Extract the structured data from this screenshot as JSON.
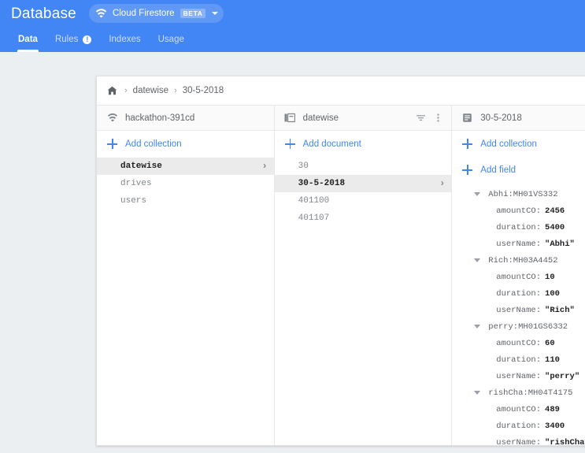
{
  "header": {
    "title": "Database",
    "product_chip": {
      "icon": "firestore-icon",
      "label": "Cloud Firestore",
      "badge": "BETA",
      "caret": "chevron-down-icon"
    },
    "accent_color": "#4285f4",
    "tabs": [
      {
        "label": "Data",
        "active": true,
        "badge": null
      },
      {
        "label": "Rules",
        "active": false,
        "badge": "!"
      },
      {
        "label": "Indexes",
        "active": false,
        "badge": null
      },
      {
        "label": "Usage",
        "active": false,
        "badge": null
      }
    ]
  },
  "breadcrumb": {
    "home_icon": "home-icon",
    "separator": "›",
    "items": [
      "datewise",
      "30-5-2018"
    ]
  },
  "panes": {
    "root": {
      "icon": "firestore-icon",
      "title": "hackathon-391cd",
      "add_label": "Add collection",
      "items": [
        {
          "name": "datewise",
          "selected": true
        },
        {
          "name": "drives",
          "selected": false
        },
        {
          "name": "users",
          "selected": false
        }
      ]
    },
    "collection": {
      "icon": "collection-icon",
      "title": "datewise",
      "filter_icon": "filter-icon",
      "menu_icon": "more-vert-icon",
      "add_label": "Add document",
      "items": [
        {
          "name": "30",
          "selected": false
        },
        {
          "name": "30-5-2018",
          "selected": true
        },
        {
          "name": "401100",
          "selected": false
        },
        {
          "name": "401107",
          "selected": false
        }
      ]
    },
    "document": {
      "icon": "document-icon",
      "title": "30-5-2018",
      "add_collection_label": "Add collection",
      "add_field_label": "Add field",
      "groups": [
        {
          "key": "Abhi:MH01VS332",
          "fields": [
            {
              "name": "amountCO",
              "value": "2456"
            },
            {
              "name": "duration",
              "value": "5400"
            },
            {
              "name": "userName",
              "value": "\"Abhi\""
            }
          ]
        },
        {
          "key": "Rich:MH03A4452",
          "fields": [
            {
              "name": "amountCO",
              "value": "10"
            },
            {
              "name": "duration",
              "value": "100"
            },
            {
              "name": "userName",
              "value": "\"Rich\""
            }
          ]
        },
        {
          "key": "perry:MH01GS6332",
          "fields": [
            {
              "name": "amountCO",
              "value": "60"
            },
            {
              "name": "duration",
              "value": "110"
            },
            {
              "name": "userName",
              "value": "\"perry\""
            }
          ]
        },
        {
          "key": "rishCha:MH04T4175",
          "fields": [
            {
              "name": "amountCO",
              "value": "489"
            },
            {
              "name": "duration",
              "value": "3400"
            },
            {
              "name": "userName",
              "value": "\"rishCha\""
            }
          ]
        }
      ]
    }
  }
}
